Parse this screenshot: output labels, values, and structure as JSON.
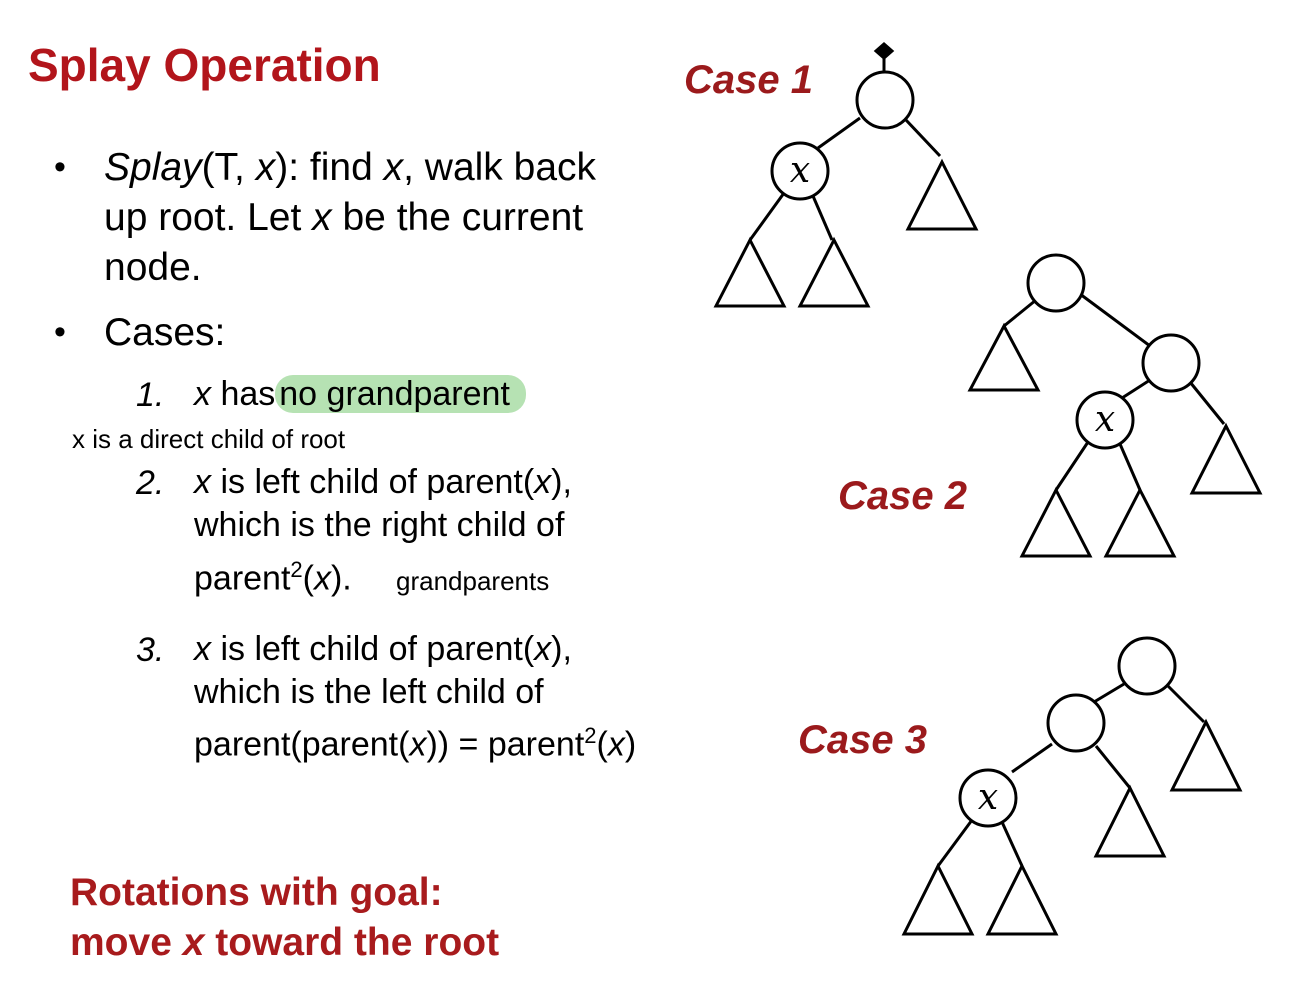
{
  "title": "Splay Operation",
  "bullet_symbol": "•",
  "bullet1": {
    "splay": "Splay",
    "args_open": "(T, ",
    "x": "x",
    "args_close": "): find ",
    "walk_back": ", walk back",
    "line2_pre": "up root. Let ",
    "line2_post": " be the current",
    "line3": "node."
  },
  "bullet2": "Cases:",
  "case1": {
    "number": "1.",
    "x": "x",
    "has": " has",
    "highlight": "no grandparent",
    "note": "x is a direct child of root"
  },
  "case2": {
    "number": "2.",
    "x": "x",
    "line1": " is left child of parent(",
    "line1_end": "),",
    "line2": "which is the right child of",
    "line3_pre": "parent",
    "sup": "2",
    "line3_open": "(",
    "line3_end": ").",
    "note": "grandparents"
  },
  "case3": {
    "number": "3.",
    "x": "x",
    "line1": " is left child of parent(",
    "line1_end": "),",
    "line2": "which is the left child of",
    "line3_pre": "parent(parent(",
    "line3_mid": ")) = parent",
    "sup": "2",
    "line3_open": "(",
    "line3_end": ")"
  },
  "goal": {
    "line1": "Rotations with goal:",
    "line2_pre": "move ",
    "x": "x",
    "line2_post": " toward the root"
  },
  "diagram_labels": {
    "case1": "Case 1",
    "case2": "Case 2",
    "case3": "Case 3",
    "node_x": "x"
  },
  "colors": {
    "title": "#b2151b",
    "case_label": "#9b1a1c",
    "highlight": "#b6e2b3"
  }
}
